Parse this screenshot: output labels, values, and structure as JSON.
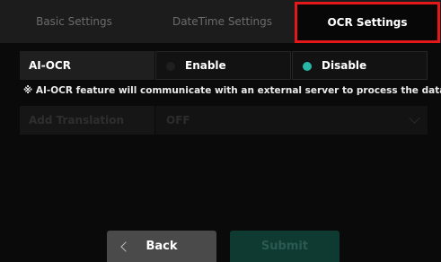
{
  "tabs": [
    {
      "label": "Basic Settings"
    },
    {
      "label": "DateTime Settings"
    },
    {
      "label": "OCR Settings",
      "selected": true
    }
  ],
  "ai_ocr": {
    "label": "AI-OCR",
    "options": [
      "Enable",
      "Disable"
    ],
    "selected": "Disable"
  },
  "notice": "※ AI-OCR feature will communicate with an external server to process the data.",
  "translation": {
    "label": "Add Translation",
    "value": "OFF"
  },
  "buttons": {
    "back": "Back",
    "submit": "Submit"
  },
  "colors": {
    "accent": "#27b7a5",
    "highlight_box": "#e41818"
  },
  "icons": {
    "back": "chevron-left-icon",
    "select": "chevron-down-icon"
  }
}
